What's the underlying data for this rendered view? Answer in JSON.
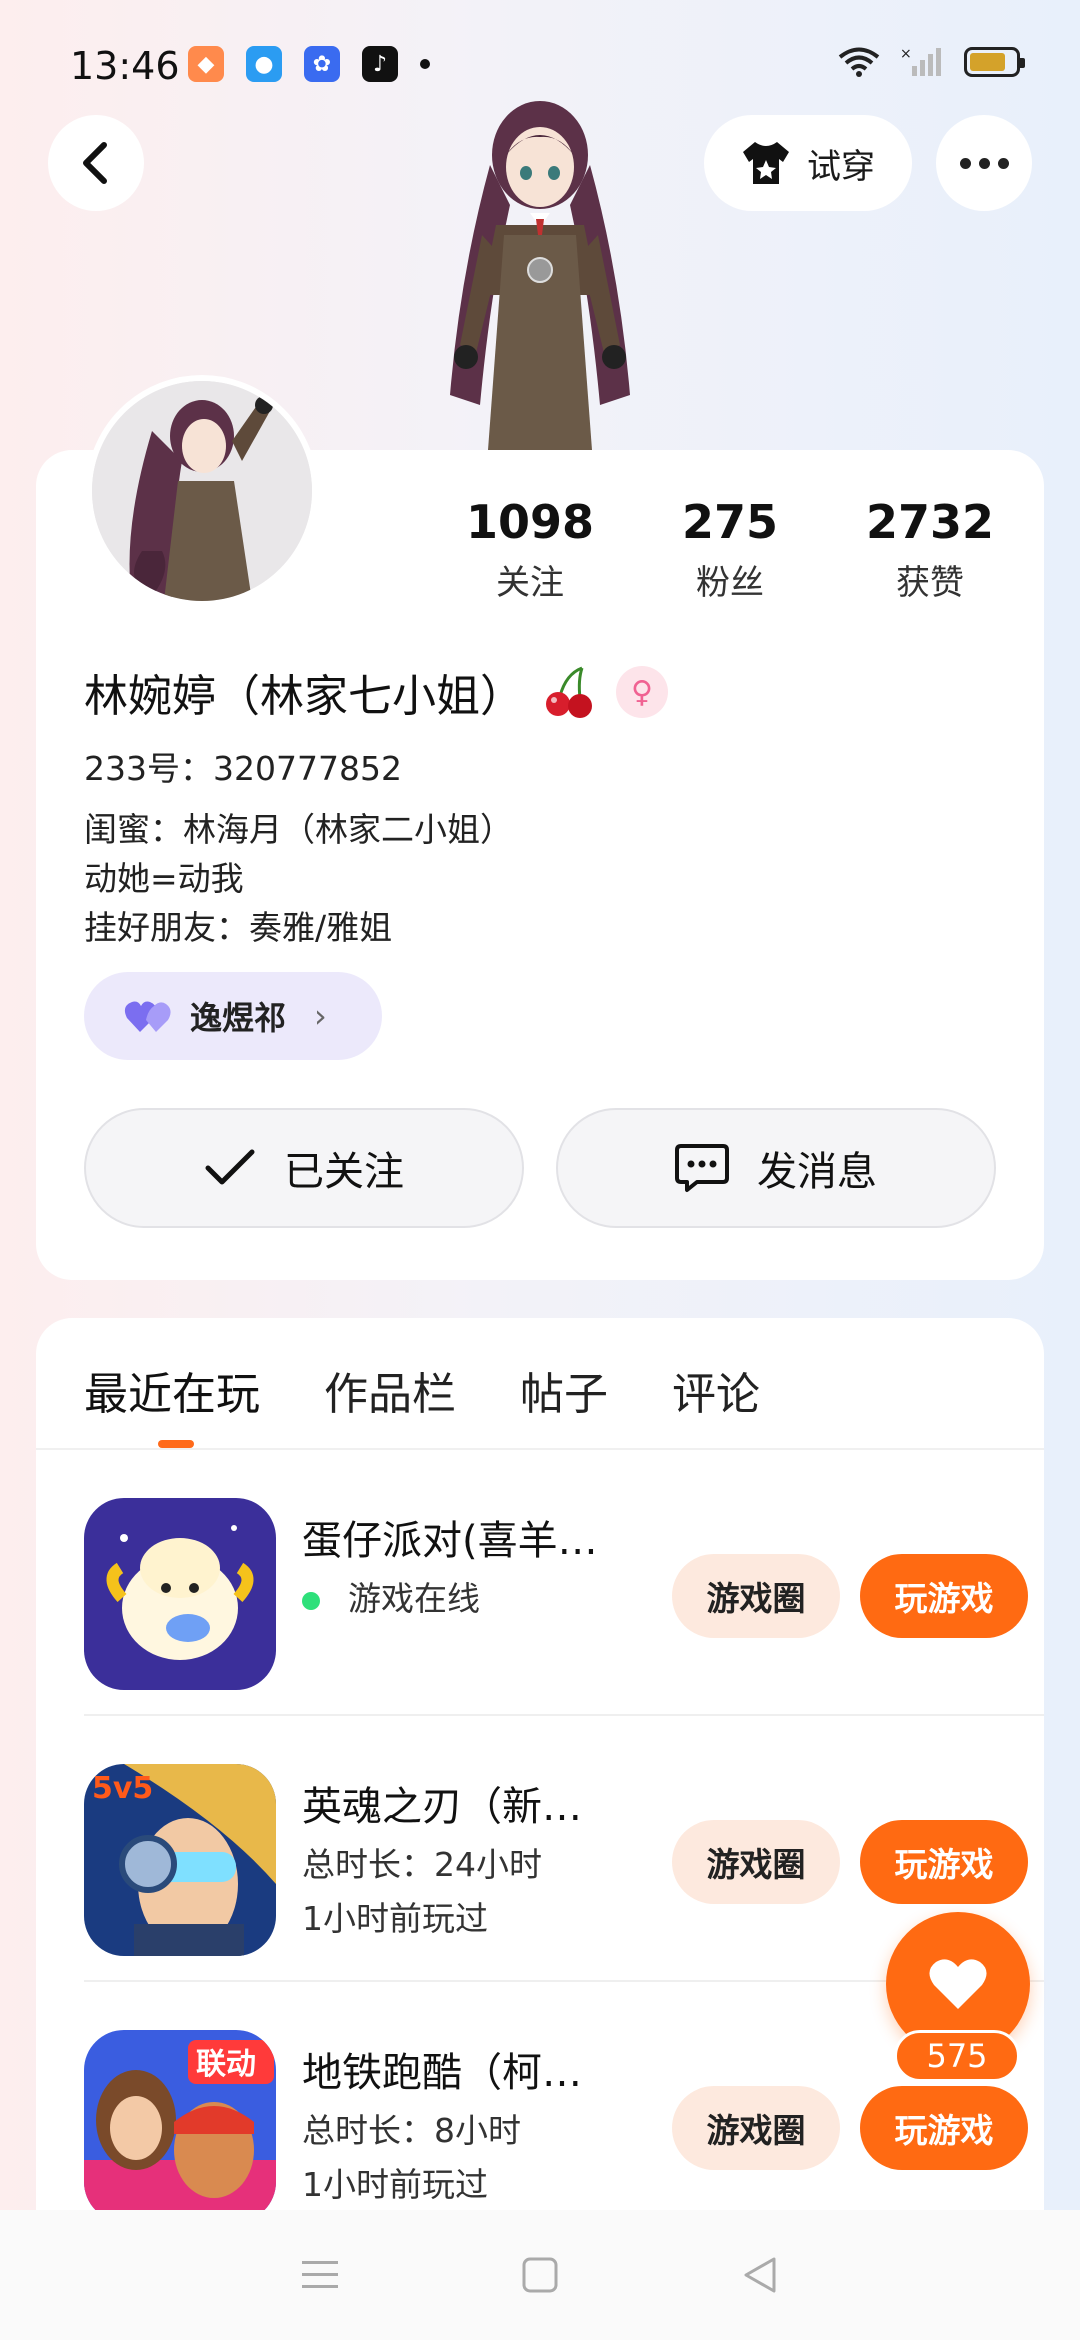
{
  "status_bar": {
    "time": "13:46"
  },
  "header": {
    "tryon_label": "试穿"
  },
  "stats": [
    {
      "num": "1098",
      "label": "关注"
    },
    {
      "num": "275",
      "label": "粉丝"
    },
    {
      "num": "2732",
      "label": "获赞"
    }
  ],
  "profile": {
    "username": "林婉婷（林家七小姐）",
    "uid": "233号：320777852",
    "bio": [
      "闺蜜：林海月（林家二小姐）",
      "动她=动我",
      "挂好朋友：奏雅/雅姐"
    ],
    "tag_label": "逸煜祁",
    "follow_label": "已关注",
    "message_label": "发消息"
  },
  "tabs": [
    "最近在玩",
    "作品栏",
    "帖子",
    "评论"
  ],
  "games": [
    {
      "title": "蛋仔派对(喜羊…",
      "line1": "游戏在线",
      "line2": "",
      "online": true,
      "circle": "游戏圈",
      "play": "玩游戏"
    },
    {
      "title": "英魂之刃（新…",
      "line1": "总时长：24小时",
      "line2": "1小时前玩过",
      "online": false,
      "circle": "游戏圈",
      "play": "玩游戏"
    },
    {
      "title": "地铁跑酷（柯…",
      "line1": "总时长：8小时",
      "line2": "1小时前玩过",
      "online": false,
      "circle": "游戏圈",
      "play": "玩游戏"
    }
  ],
  "like": {
    "count": "575"
  },
  "colors": {
    "accent": "#ff6a12",
    "chip": "#ece9fb",
    "circle_btn": "#fde9de"
  }
}
